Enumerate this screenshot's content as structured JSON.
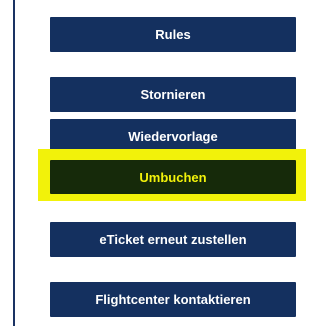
{
  "actions": {
    "rules_label": "Rules",
    "stornieren_label": "Stornieren",
    "wiedervorlage_label": "Wiedervorlage",
    "umbuchen_label": "Umbuchen",
    "eticket_label": "eTicket erneut zustellen",
    "flightcenter_label": "Flightcenter kontaktieren"
  },
  "colors": {
    "button_bg": "#14305f",
    "button_text": "#ffffff",
    "highlight": "#f2f20a",
    "highlighted_button_bg": "#162a0a",
    "highlighted_button_text": "#f2f20a"
  }
}
